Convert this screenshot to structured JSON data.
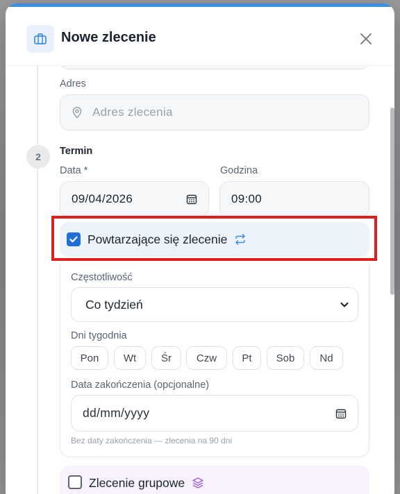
{
  "modal": {
    "title": "Nowe zlecenie",
    "icon": "briefcase-icon",
    "accent_color": "#3d8de0"
  },
  "address": {
    "label": "Adres",
    "placeholder": "Adres zlecenia",
    "icon": "map-pin-icon"
  },
  "step": {
    "number": "2",
    "title": "Termin"
  },
  "date": {
    "label": "Data *",
    "value": "09/04/2026"
  },
  "time": {
    "label": "Godzina",
    "value": "09:00"
  },
  "recurring": {
    "label": "Powtarzające się zlecenie",
    "checked": true,
    "icon": "repeat-icon",
    "checkbox_color": "#1f6fd8"
  },
  "frequency": {
    "label": "Częstotliwość",
    "selected": "Co tydzień"
  },
  "weekdays": {
    "label": "Dni tygodnia",
    "days": [
      "Pon",
      "Wt",
      "Śr",
      "Czw",
      "Pt",
      "Sob",
      "Nd"
    ]
  },
  "end_date": {
    "label": "Data zakończenia (opcjonalne)",
    "value": "dd/mm/yyyy",
    "hint": "Bez daty zakończenia — zlecenia na 90 dni"
  },
  "group_order": {
    "label": "Zlecenie grupowe",
    "checked": false,
    "icon": "layers-icon",
    "icon_color": "#a05ce0"
  },
  "highlight_color": "#e02020"
}
